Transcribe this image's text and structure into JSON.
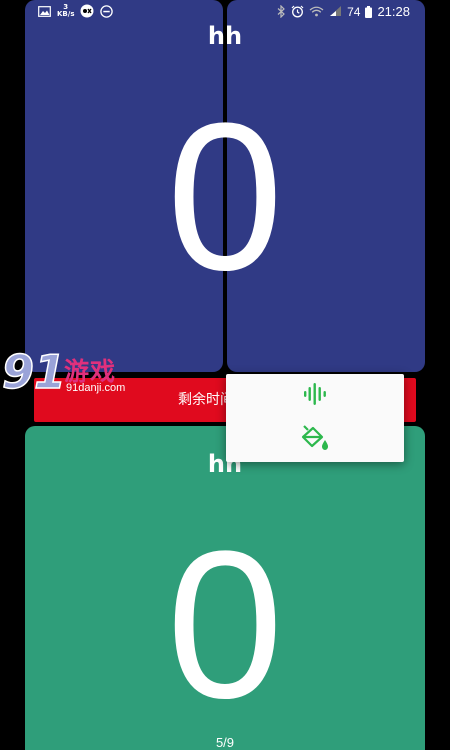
{
  "status_bar": {
    "left_icons": [
      "image-icon",
      "network-speed-icon",
      "app-badge-icon",
      "do-not-disturb-icon"
    ],
    "speed_value": "3",
    "speed_unit": "KB/s",
    "right_icons": [
      "bluetooth-icon",
      "alarm-icon",
      "wifi-icon",
      "signal-icon",
      "battery-icon"
    ],
    "battery": "74",
    "time": "21:28"
  },
  "top_team": {
    "name": "hh",
    "score": "0",
    "color": "#303a85"
  },
  "bottom_team": {
    "name": "hh",
    "score": "0",
    "color": "#2f9e7a"
  },
  "timer": {
    "label": "剩余时间",
    "color": "#e00a1e"
  },
  "popup_menu": {
    "items": [
      {
        "icon": "sound-wave-icon"
      },
      {
        "icon": "paint-bucket-icon"
      }
    ],
    "icon_color": "#2db84d"
  },
  "watermark": {
    "logo": "91",
    "text": "游戏",
    "url": "91danji.com"
  },
  "page_indicator": "5/9"
}
